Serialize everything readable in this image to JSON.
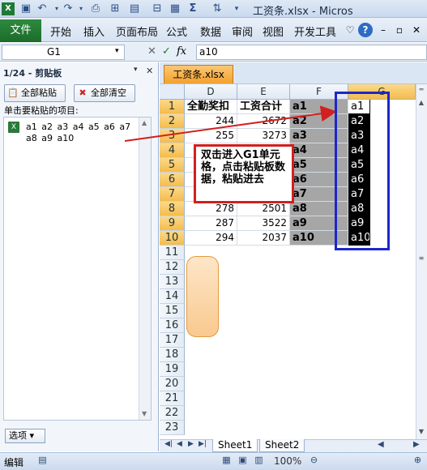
{
  "title": {
    "text": "工资条.xlsx - Micros"
  },
  "ribbon": {
    "file": "文件",
    "tabs": [
      "开始",
      "插入",
      "页面布局",
      "公式",
      "数据",
      "审阅",
      "视图",
      "开发工具"
    ]
  },
  "formula_bar": {
    "name_box": "G1",
    "fx": "fx",
    "value": "a10"
  },
  "clipboard_pane": {
    "title": "1/24 - 剪贴板",
    "paste_all": "全部粘贴",
    "clear_all": "全部清空",
    "hint": "单击要粘贴的项目:",
    "item_text": "a1 a2 a3 a4 a5 a6 a7 a8 a9 a10",
    "options": "选项 ▾"
  },
  "workbook": {
    "tab": "工资条.xlsx"
  },
  "grid": {
    "columns": [
      "D",
      "E",
      "F",
      "G"
    ],
    "rows": [
      {
        "n": "1",
        "d": "全勤奖扣",
        "e": "工资合计",
        "f": "a1",
        "g": "a1"
      },
      {
        "n": "2",
        "d": "244",
        "e": "2672",
        "f": "a2",
        "g": "a2"
      },
      {
        "n": "3",
        "d": "255",
        "e": "3273",
        "f": "a3",
        "g": "a3"
      },
      {
        "n": "4",
        "d": "",
        "e": "",
        "f": "a4",
        "g": "a4"
      },
      {
        "n": "5",
        "d": "",
        "e": "",
        "f": "a5",
        "g": "a5"
      },
      {
        "n": "6",
        "d": "",
        "e": "",
        "f": "a6",
        "g": "a6"
      },
      {
        "n": "7",
        "d": "",
        "e": "",
        "f": "a7",
        "g": "a7"
      },
      {
        "n": "8",
        "d": "278",
        "e": "2501",
        "f": "a8",
        "g": "a8"
      },
      {
        "n": "9",
        "d": "287",
        "e": "3522",
        "f": "a9",
        "g": "a9"
      },
      {
        "n": "10",
        "d": "294",
        "e": "2037",
        "f": "a10",
        "g": "a10"
      }
    ],
    "empty_rows": [
      "11",
      "12",
      "13",
      "14",
      "15",
      "16",
      "17",
      "18",
      "19",
      "20",
      "21",
      "22",
      "23"
    ]
  },
  "callout": {
    "text": "双击进入G1单元格，点击粘贴板数据，粘贴进去"
  },
  "sheets": {
    "tabs": [
      "Sheet1",
      "Sheet2"
    ]
  },
  "status": {
    "mode": "编辑",
    "zoom": "100%"
  },
  "colors": {
    "excel_green": "#1c6b2b",
    "callout_border": "#d21f1f",
    "blue_box": "#1d27c9",
    "f_column": "#a6a6a6"
  }
}
